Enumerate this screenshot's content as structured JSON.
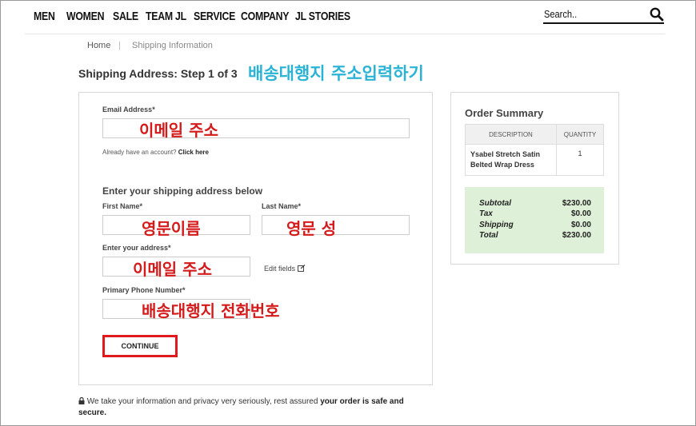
{
  "nav": {
    "items": [
      "MEN",
      "WOMEN",
      "SALE",
      "TEAM JL",
      "SERVICE",
      "COMPANY",
      "JL STORIES"
    ],
    "search_placeholder": "Search.."
  },
  "breadcrumb": {
    "home": "Home",
    "separator": "|",
    "current": "Shipping Information"
  },
  "page": {
    "title": "Shipping Address: Step 1 of 3",
    "title_annotation": "배송대행지 주소입력하기"
  },
  "form": {
    "email_label": "Email Address*",
    "email_annotation": "이메일 주소",
    "account_text": "Already have an account?",
    "account_link": "Click here",
    "section_heading": "Enter your shipping address below",
    "first_name_label": "First Name*",
    "first_name_annotation": "영문이름",
    "last_name_label": "Last Name*",
    "last_name_annotation": "영문 성",
    "address_label": "Enter your address*",
    "address_annotation": "이메일 주소",
    "edit_fields": "Edit fields",
    "phone_label": "Primary Phone Number*",
    "phone_annotation": "배송대행지 전화번호",
    "continue_label": "CONTINUE"
  },
  "summary": {
    "title": "Order Summary",
    "col_description": "DESCRIPTION",
    "col_quantity": "QUANTITY",
    "item_name": "Ysabel Stretch Satin Belted Wrap Dress",
    "item_qty": "1",
    "subtotal_label": "Subtotal",
    "subtotal_value": "$230.00",
    "tax_label": "Tax",
    "tax_value": "$0.00",
    "shipping_label": "Shipping",
    "shipping_value": "$0.00",
    "total_label": "Total",
    "total_value": "$230.00"
  },
  "footer": {
    "note": "We take your information and privacy very seriously, rest assured",
    "note_bold": "your order is safe and secure."
  },
  "colors": {
    "annotation_red": "#d41a1a",
    "annotation_blue": "#2ab3d4",
    "button_border": "#e0191c",
    "totals_bg": "#dff0d8"
  }
}
